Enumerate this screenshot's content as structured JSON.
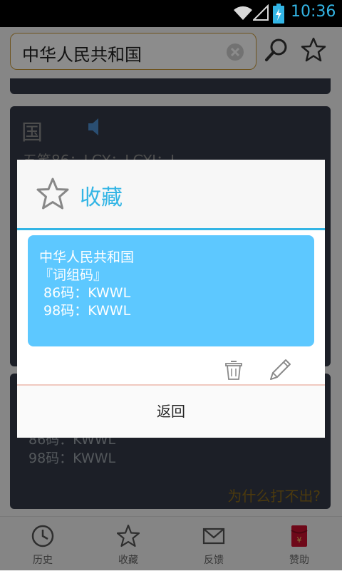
{
  "status_bar": {
    "time": "10:36"
  },
  "search": {
    "query": "中华人民共和国"
  },
  "background_cards": {
    "char_card": {
      "character": "国",
      "wubi_line": "五笔86：LGY；LGYI；L"
    },
    "phrase_card": {
      "code86": "86码：KWWL",
      "code98": "98码：KWWL",
      "help_link": "为什么打不出?"
    }
  },
  "bottom_nav": {
    "items": [
      {
        "label": "历史",
        "icon": "clock-icon"
      },
      {
        "label": "收藏",
        "icon": "star-icon"
      },
      {
        "label": "反馈",
        "icon": "mail-icon"
      },
      {
        "label": "赞助",
        "icon": "red-envelope-icon"
      }
    ]
  },
  "dialog": {
    "title": "收藏",
    "favorite": {
      "word": "中华人民共和国",
      "type": "『词组码』",
      "code86": " 86码：KWWL",
      "code98": " 98码：KWWL"
    },
    "back_label": "返回"
  },
  "colors": {
    "accent": "#33b5e5",
    "item_bg": "#5dc8ff",
    "card_bg": "#333a47"
  }
}
